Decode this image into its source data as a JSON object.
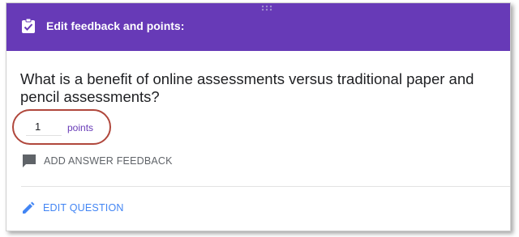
{
  "header": {
    "title": "Edit feedback and points:",
    "icon": "clipboard-check-icon",
    "background_color": "#673ab7"
  },
  "question": {
    "text": "What is a benefit of online assessments versus traditional paper and pencil assessments?"
  },
  "points": {
    "value": "1",
    "label": "points",
    "label_color": "#673ab7",
    "highlight_color": "#b0473c"
  },
  "feedback": {
    "label": "ADD ANSWER FEEDBACK",
    "icon": "comment-icon"
  },
  "edit": {
    "label": "EDIT QUESTION",
    "icon": "pencil-icon",
    "color": "#4285f4"
  }
}
